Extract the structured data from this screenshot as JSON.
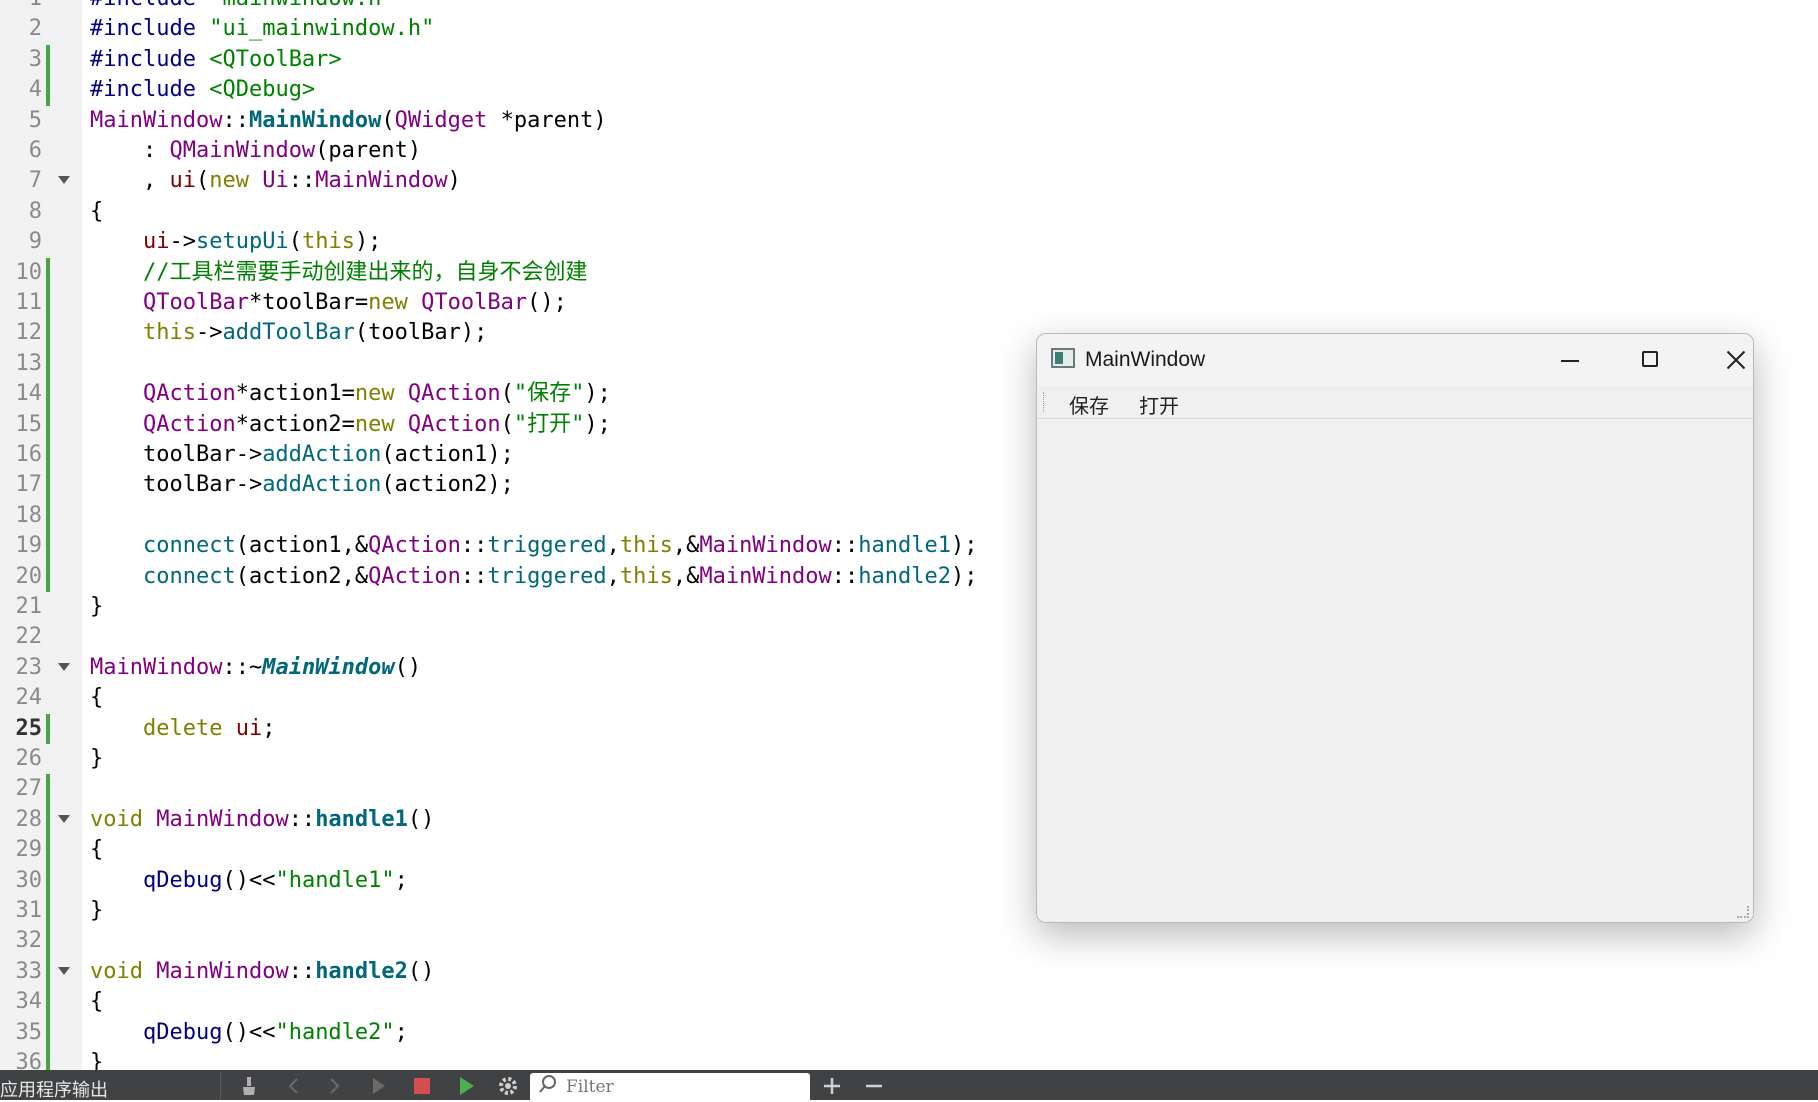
{
  "editor": {
    "current_line": 25,
    "lines": [
      {
        "n": "1",
        "mod": false,
        "fold": false,
        "tokens": [
          [
            "pre",
            "#include "
          ],
          [
            "str",
            "\"mainwindow.h\""
          ]
        ]
      },
      {
        "n": "2",
        "mod": false,
        "fold": false,
        "tokens": [
          [
            "pre",
            "#include "
          ],
          [
            "str",
            "\"ui_mainwindow.h\""
          ]
        ]
      },
      {
        "n": "3",
        "mod": true,
        "fold": false,
        "tokens": [
          [
            "pre",
            "#include "
          ],
          [
            "str",
            "<QToolBar>"
          ]
        ]
      },
      {
        "n": "4",
        "mod": true,
        "fold": false,
        "tokens": [
          [
            "pre",
            "#include "
          ],
          [
            "str",
            "<QDebug>"
          ]
        ]
      },
      {
        "n": "5",
        "mod": false,
        "fold": false,
        "tokens": [
          [
            "type",
            "MainWindow"
          ],
          [
            "txt",
            "::"
          ],
          [
            "fnb",
            "MainWindow"
          ],
          [
            "txt",
            "("
          ],
          [
            "type",
            "QWidget"
          ],
          [
            "txt",
            " *parent)"
          ]
        ]
      },
      {
        "n": "6",
        "mod": false,
        "fold": false,
        "tokens": [
          [
            "txt",
            "    : "
          ],
          [
            "type",
            "QMainWindow"
          ],
          [
            "txt",
            "(parent)"
          ]
        ]
      },
      {
        "n": "7",
        "mod": false,
        "fold": true,
        "tokens": [
          [
            "txt",
            "    , "
          ],
          [
            "var",
            "ui"
          ],
          [
            "txt",
            "("
          ],
          [
            "kw",
            "new "
          ],
          [
            "type",
            "Ui"
          ],
          [
            "txt",
            "::"
          ],
          [
            "type",
            "MainWindow"
          ],
          [
            "txt",
            ")"
          ]
        ]
      },
      {
        "n": "8",
        "mod": false,
        "fold": false,
        "tokens": [
          [
            "txt",
            "{"
          ]
        ]
      },
      {
        "n": "9",
        "mod": false,
        "fold": false,
        "tokens": [
          [
            "txt",
            "    "
          ],
          [
            "var",
            "ui"
          ],
          [
            "txt",
            "->"
          ],
          [
            "fn",
            "setupUi"
          ],
          [
            "txt",
            "("
          ],
          [
            "kw",
            "this"
          ],
          [
            "txt",
            ");"
          ]
        ]
      },
      {
        "n": "10",
        "mod": true,
        "fold": false,
        "tokens": [
          [
            "txt",
            "    "
          ],
          [
            "cm",
            "//工具栏需要手动创建出来的，自身不会创建"
          ]
        ]
      },
      {
        "n": "11",
        "mod": true,
        "fold": false,
        "tokens": [
          [
            "txt",
            "    "
          ],
          [
            "type",
            "QToolBar"
          ],
          [
            "txt",
            "*toolBar="
          ],
          [
            "kw",
            "new "
          ],
          [
            "type",
            "QToolBar"
          ],
          [
            "txt",
            "();"
          ]
        ]
      },
      {
        "n": "12",
        "mod": true,
        "fold": false,
        "tokens": [
          [
            "txt",
            "    "
          ],
          [
            "kw",
            "this"
          ],
          [
            "txt",
            "->"
          ],
          [
            "fn",
            "addToolBar"
          ],
          [
            "txt",
            "(toolBar);"
          ]
        ]
      },
      {
        "n": "13",
        "mod": true,
        "fold": false,
        "tokens": []
      },
      {
        "n": "14",
        "mod": true,
        "fold": false,
        "tokens": [
          [
            "txt",
            "    "
          ],
          [
            "type",
            "QAction"
          ],
          [
            "txt",
            "*action1="
          ],
          [
            "kw",
            "new "
          ],
          [
            "type",
            "QAction"
          ],
          [
            "txt",
            "("
          ],
          [
            "str",
            "\"保存\""
          ],
          [
            "txt",
            ");"
          ]
        ]
      },
      {
        "n": "15",
        "mod": true,
        "fold": false,
        "tokens": [
          [
            "txt",
            "    "
          ],
          [
            "type",
            "QAction"
          ],
          [
            "txt",
            "*action2="
          ],
          [
            "kw",
            "new "
          ],
          [
            "type",
            "QAction"
          ],
          [
            "txt",
            "("
          ],
          [
            "str",
            "\"打开\""
          ],
          [
            "txt",
            ");"
          ]
        ]
      },
      {
        "n": "16",
        "mod": true,
        "fold": false,
        "tokens": [
          [
            "txt",
            "    toolBar->"
          ],
          [
            "fn",
            "addAction"
          ],
          [
            "txt",
            "(action1);"
          ]
        ]
      },
      {
        "n": "17",
        "mod": true,
        "fold": false,
        "tokens": [
          [
            "txt",
            "    toolBar->"
          ],
          [
            "fn",
            "addAction"
          ],
          [
            "txt",
            "(action2);"
          ]
        ]
      },
      {
        "n": "18",
        "mod": true,
        "fold": false,
        "tokens": []
      },
      {
        "n": "19",
        "mod": true,
        "fold": false,
        "tokens": [
          [
            "txt",
            "    "
          ],
          [
            "fn",
            "connect"
          ],
          [
            "txt",
            "(action1,&"
          ],
          [
            "type",
            "QAction"
          ],
          [
            "txt",
            "::"
          ],
          [
            "fn",
            "triggered"
          ],
          [
            "txt",
            ","
          ],
          [
            "kw",
            "this"
          ],
          [
            "txt",
            ",&"
          ],
          [
            "type",
            "MainWindow"
          ],
          [
            "txt",
            "::"
          ],
          [
            "fn",
            "handle1"
          ],
          [
            "txt",
            ");"
          ]
        ]
      },
      {
        "n": "20",
        "mod": true,
        "fold": false,
        "tokens": [
          [
            "txt",
            "    "
          ],
          [
            "fn",
            "connect"
          ],
          [
            "txt",
            "(action2,&"
          ],
          [
            "type",
            "QAction"
          ],
          [
            "txt",
            "::"
          ],
          [
            "fn",
            "triggered"
          ],
          [
            "txt",
            ","
          ],
          [
            "kw",
            "this"
          ],
          [
            "txt",
            ",&"
          ],
          [
            "type",
            "MainWindow"
          ],
          [
            "txt",
            "::"
          ],
          [
            "fn",
            "handle2"
          ],
          [
            "txt",
            ");"
          ]
        ]
      },
      {
        "n": "21",
        "mod": false,
        "fold": false,
        "tokens": [
          [
            "txt",
            "}"
          ]
        ]
      },
      {
        "n": "22",
        "mod": false,
        "fold": false,
        "tokens": []
      },
      {
        "n": "23",
        "mod": false,
        "fold": true,
        "tokens": [
          [
            "type",
            "MainWindow"
          ],
          [
            "txt",
            "::~"
          ],
          [
            "fni",
            "MainWindow"
          ],
          [
            "txt",
            "()"
          ]
        ]
      },
      {
        "n": "24",
        "mod": false,
        "fold": false,
        "tokens": [
          [
            "txt",
            "{"
          ]
        ]
      },
      {
        "n": "25",
        "mod": true,
        "fold": false,
        "tokens": [
          [
            "txt",
            "    "
          ],
          [
            "kw",
            "delete "
          ],
          [
            "var",
            "ui"
          ],
          [
            "txt",
            ";"
          ]
        ]
      },
      {
        "n": "26",
        "mod": false,
        "fold": false,
        "tokens": [
          [
            "txt",
            "}"
          ]
        ]
      },
      {
        "n": "27",
        "mod": true,
        "fold": false,
        "tokens": []
      },
      {
        "n": "28",
        "mod": true,
        "fold": true,
        "tokens": [
          [
            "kw",
            "void "
          ],
          [
            "type",
            "MainWindow"
          ],
          [
            "txt",
            "::"
          ],
          [
            "fnb",
            "handle1"
          ],
          [
            "txt",
            "()"
          ]
        ]
      },
      {
        "n": "29",
        "mod": true,
        "fold": false,
        "tokens": [
          [
            "txt",
            "{"
          ]
        ]
      },
      {
        "n": "30",
        "mod": true,
        "fold": false,
        "tokens": [
          [
            "txt",
            "    "
          ],
          [
            "pre",
            "qDebug"
          ],
          [
            "txt",
            "()<<"
          ],
          [
            "str",
            "\"handle1\""
          ],
          [
            "txt",
            ";"
          ]
        ]
      },
      {
        "n": "31",
        "mod": true,
        "fold": false,
        "tokens": [
          [
            "txt",
            "}"
          ]
        ]
      },
      {
        "n": "32",
        "mod": true,
        "fold": false,
        "tokens": []
      },
      {
        "n": "33",
        "mod": true,
        "fold": true,
        "tokens": [
          [
            "kw",
            "void "
          ],
          [
            "type",
            "MainWindow"
          ],
          [
            "txt",
            "::"
          ],
          [
            "fnb",
            "handle2"
          ],
          [
            "txt",
            "()"
          ]
        ]
      },
      {
        "n": "34",
        "mod": true,
        "fold": false,
        "tokens": [
          [
            "txt",
            "{"
          ]
        ]
      },
      {
        "n": "35",
        "mod": true,
        "fold": false,
        "tokens": [
          [
            "txt",
            "    "
          ],
          [
            "pre",
            "qDebug"
          ],
          [
            "txt",
            "()<<"
          ],
          [
            "str",
            "\"handle2\""
          ],
          [
            "txt",
            ";"
          ]
        ]
      },
      {
        "n": "36",
        "mod": true,
        "fold": false,
        "tokens": [
          [
            "txt",
            "}"
          ]
        ]
      }
    ]
  },
  "app_window": {
    "title": "MainWindow",
    "toolbar_actions": [
      "保存",
      "打开"
    ],
    "icons": {
      "minimize": "minimize-icon",
      "maximize": "maximize-icon",
      "close": "close-icon"
    }
  },
  "output_pane": {
    "title": "应用程序输出",
    "filter_placeholder": "Filter",
    "icons": [
      "clean-icon",
      "prev-icon",
      "next-icon",
      "run-icon",
      "stop-icon",
      "debug-run-icon",
      "settings-icon",
      "filter-icon",
      "add-icon",
      "remove-icon"
    ]
  },
  "colors": {
    "modified_marker": "#47a447",
    "gutter_bg": "#f2f2f2",
    "output_bar_bg": "#404244"
  }
}
